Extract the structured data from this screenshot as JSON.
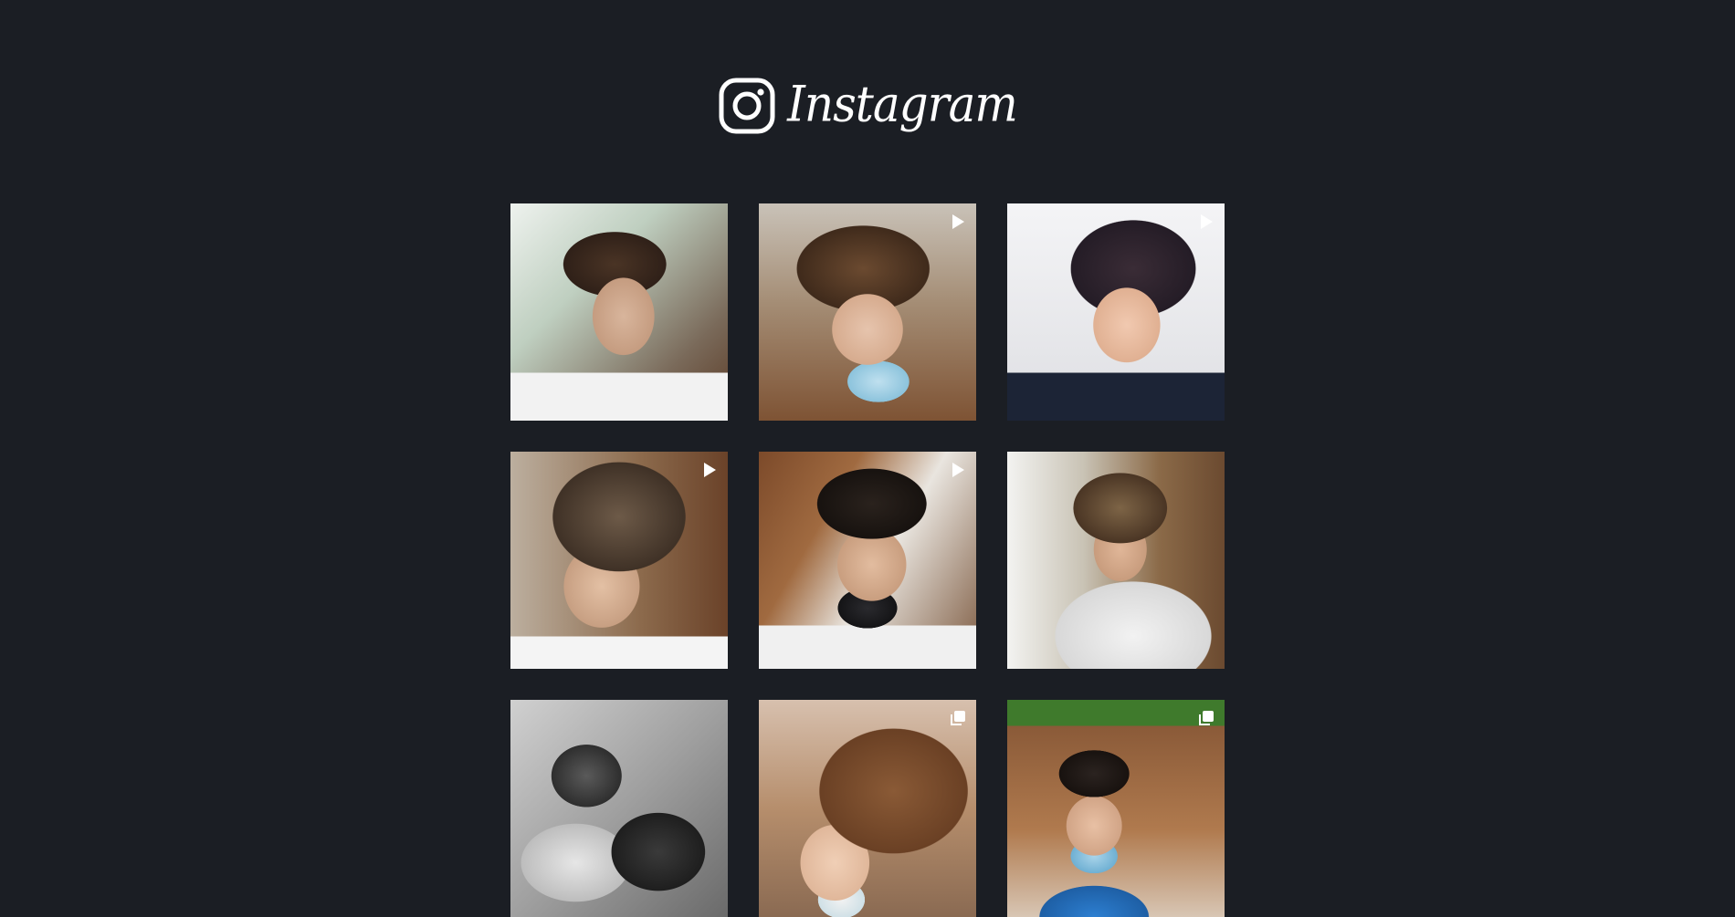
{
  "header": {
    "wordmark": "Instagram",
    "logo_icon": "instagram-glyph-icon"
  },
  "colors": {
    "background": "#1b1e24",
    "foreground": "#ffffff"
  },
  "posts": [
    {
      "badge": "none"
    },
    {
      "badge": "video-icon"
    },
    {
      "badge": "video-icon"
    },
    {
      "badge": "video-icon"
    },
    {
      "badge": "video-icon"
    },
    {
      "badge": "none"
    },
    {
      "badge": "none"
    },
    {
      "badge": "carousel-icon"
    },
    {
      "badge": "carousel-icon"
    }
  ]
}
